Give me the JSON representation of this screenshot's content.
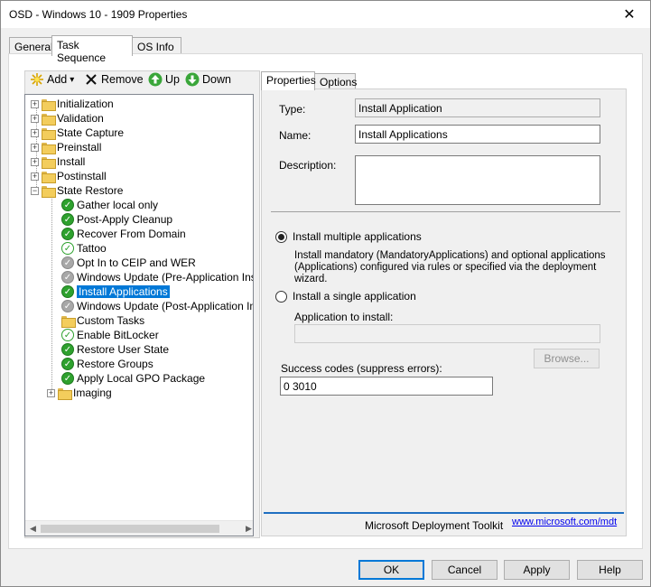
{
  "window": {
    "title": "OSD - Windows 10 - 1909 Properties",
    "close_glyph": "✕"
  },
  "tabs": [
    {
      "label": "General"
    },
    {
      "label": "Task Sequence"
    },
    {
      "label": "OS Info"
    }
  ],
  "toolbar": {
    "add_label": "Add",
    "add_arrow": "▾",
    "remove_label": "Remove",
    "up_label": "Up",
    "down_label": "Down"
  },
  "tree": {
    "items": [
      {
        "label": "Initialization",
        "type": "group"
      },
      {
        "label": "Validation",
        "type": "group"
      },
      {
        "label": "State Capture",
        "type": "group"
      },
      {
        "label": "Preinstall",
        "type": "group"
      },
      {
        "label": "Install",
        "type": "group"
      },
      {
        "label": "Postinstall",
        "type": "group"
      },
      {
        "label": "State Restore",
        "type": "group-expanded"
      },
      {
        "label": "Gather local only",
        "type": "step",
        "status": "green"
      },
      {
        "label": "Post-Apply Cleanup",
        "type": "step",
        "status": "green"
      },
      {
        "label": "Recover From Domain",
        "type": "step",
        "status": "green"
      },
      {
        "label": "Tattoo",
        "type": "step",
        "status": "outline"
      },
      {
        "label": "Opt In to CEIP and WER",
        "type": "step",
        "status": "gray"
      },
      {
        "label": "Windows Update (Pre-Application Installa",
        "type": "step",
        "status": "gray"
      },
      {
        "label": "Install Applications",
        "type": "step",
        "status": "green",
        "selected": true
      },
      {
        "label": "Windows Update (Post-Application Installa",
        "type": "step",
        "status": "gray"
      },
      {
        "label": "Custom Tasks",
        "type": "folder"
      },
      {
        "label": "Enable BitLocker",
        "type": "step",
        "status": "outline"
      },
      {
        "label": "Restore User State",
        "type": "step",
        "status": "green"
      },
      {
        "label": "Restore Groups",
        "type": "step",
        "status": "green"
      },
      {
        "label": "Apply Local GPO Package",
        "type": "step",
        "status": "green"
      },
      {
        "label": "Imaging",
        "type": "group-sub"
      }
    ]
  },
  "props": {
    "tabs": [
      {
        "label": "Properties"
      },
      {
        "label": "Options"
      }
    ],
    "type_label": "Type:",
    "type_value": "Install Application",
    "name_label": "Name:",
    "name_value": "Install Applications",
    "description_label": "Description:",
    "description_value": "",
    "radio_multiple": "Install multiple applications",
    "multiple_desc_1": "Install mandatory (MandatoryApplications) and optional applications",
    "multiple_desc_2": "(Applications) configured via rules or specified via the deployment",
    "multiple_desc_3": "wizard.",
    "radio_single": "Install a single application",
    "app_label": "Application to install:",
    "app_value": "",
    "browse_label": "Browse...",
    "success_label": "Success codes (suppress errors):",
    "success_value": "0 3010",
    "mdt_label": "Microsoft Deployment Toolkit",
    "mdt_link": "www.microsoft.com/mdt"
  },
  "buttons": {
    "ok": "OK",
    "cancel": "Cancel",
    "apply": "Apply",
    "help": "Help"
  }
}
